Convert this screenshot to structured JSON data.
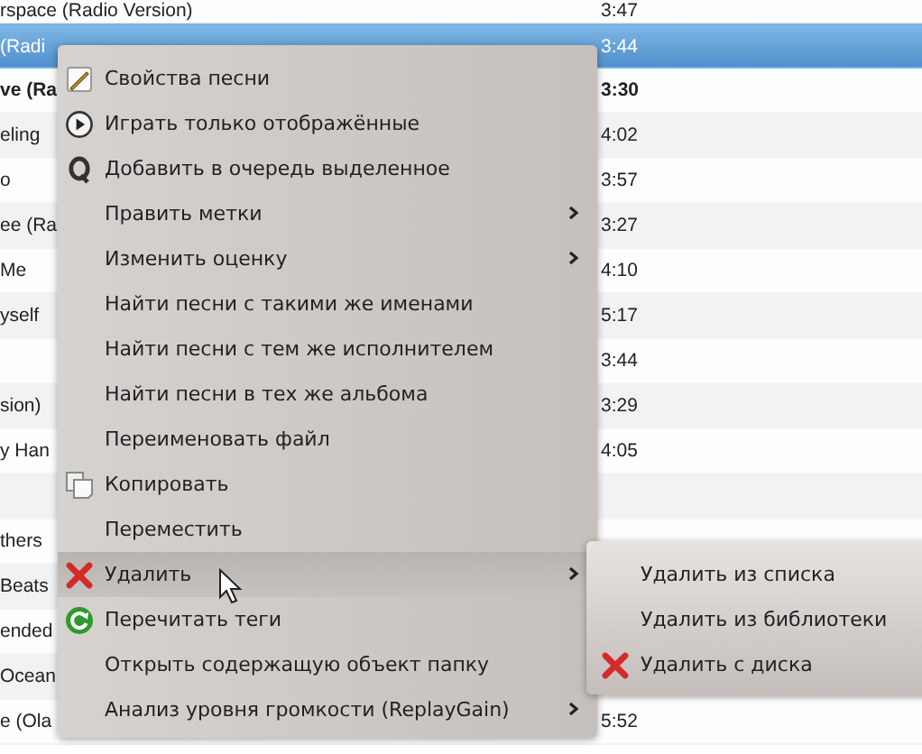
{
  "table": {
    "rows": [
      {
        "title": "rspace (Radio Version)",
        "length": "3:47",
        "selected": false,
        "playing": false
      },
      {
        "title": "(Radi",
        "length": "3:44",
        "selected": true,
        "playing": false
      },
      {
        "title": "ve (Ra",
        "length": "3:30",
        "selected": false,
        "playing": true
      },
      {
        "title": "eling",
        "length": "4:02",
        "selected": false,
        "playing": false
      },
      {
        "title": "o",
        "length": "3:57",
        "selected": false,
        "playing": false
      },
      {
        "title": "ee (Ra",
        "length": "3:27",
        "selected": false,
        "playing": false
      },
      {
        "title": "Me",
        "length": "4:10",
        "selected": false,
        "playing": false
      },
      {
        "title": "yself",
        "length": "5:17",
        "selected": false,
        "playing": false
      },
      {
        "length": "3:44",
        "selected": false,
        "playing": false
      },
      {
        "title": "sion)",
        "length": "3:29",
        "selected": false,
        "playing": false
      },
      {
        "title": "y Han",
        "length": "4:05",
        "selected": false,
        "playing": false
      },
      {
        "selected": false
      },
      {
        "title": "thers",
        "selected": false,
        "playing": false
      },
      {
        "title": "Beats",
        "selected": false,
        "playing": false
      },
      {
        "title": "ended",
        "selected": false,
        "playing": false
      },
      {
        "title": "Ocean",
        "selected": false,
        "playing": false
      },
      {
        "title": "e (Ola",
        "length": "5:52",
        "selected": false,
        "playing": false
      }
    ]
  },
  "context_menu": {
    "items": [
      {
        "label": "Свойства песни",
        "kind": "properties",
        "submenu": false,
        "selected": false
      },
      {
        "label": "Играть только отображённые",
        "kind": "play",
        "submenu": false,
        "selected": false
      },
      {
        "label": "Добавить в очередь выделенное",
        "kind": "queue",
        "submenu": false,
        "selected": false
      },
      {
        "label": "Править метки",
        "kind": "plain",
        "submenu": true,
        "selected": false
      },
      {
        "label": "Изменить оценку",
        "kind": "plain",
        "submenu": true,
        "selected": false
      },
      {
        "label": "Найти песни с такими же именами",
        "kind": "plain",
        "submenu": false,
        "selected": false
      },
      {
        "label": "Найти песни с тем же исполнителем",
        "kind": "plain",
        "submenu": false,
        "selected": false
      },
      {
        "label": "Найти песни в тех же альбома",
        "kind": "plain",
        "submenu": false,
        "selected": false
      },
      {
        "label": "Переименовать файл",
        "kind": "plain",
        "submenu": false,
        "selected": false
      },
      {
        "label": "Копировать",
        "kind": "copy",
        "submenu": false,
        "selected": false
      },
      {
        "label": "Переместить",
        "kind": "plain",
        "submenu": false,
        "selected": false
      },
      {
        "label": "Удалить",
        "kind": "delete",
        "submenu": true,
        "selected": true
      },
      {
        "label": "Перечитать теги",
        "kind": "reload",
        "submenu": false,
        "selected": false
      },
      {
        "label": "Открыть содержащую объект папку",
        "kind": "plain",
        "submenu": false,
        "selected": false
      },
      {
        "label": "Анализ уровня громкости (ReplayGain)",
        "kind": "plain",
        "submenu": true,
        "selected": false
      }
    ]
  },
  "submenu": {
    "items": [
      {
        "label": "Удалить из списка",
        "kind": "plain",
        "selected": false
      },
      {
        "label": "Удалить из библиотеки",
        "kind": "plain",
        "selected": false
      },
      {
        "label": "Удалить с диска",
        "kind": "delete",
        "selected": false
      }
    ]
  }
}
